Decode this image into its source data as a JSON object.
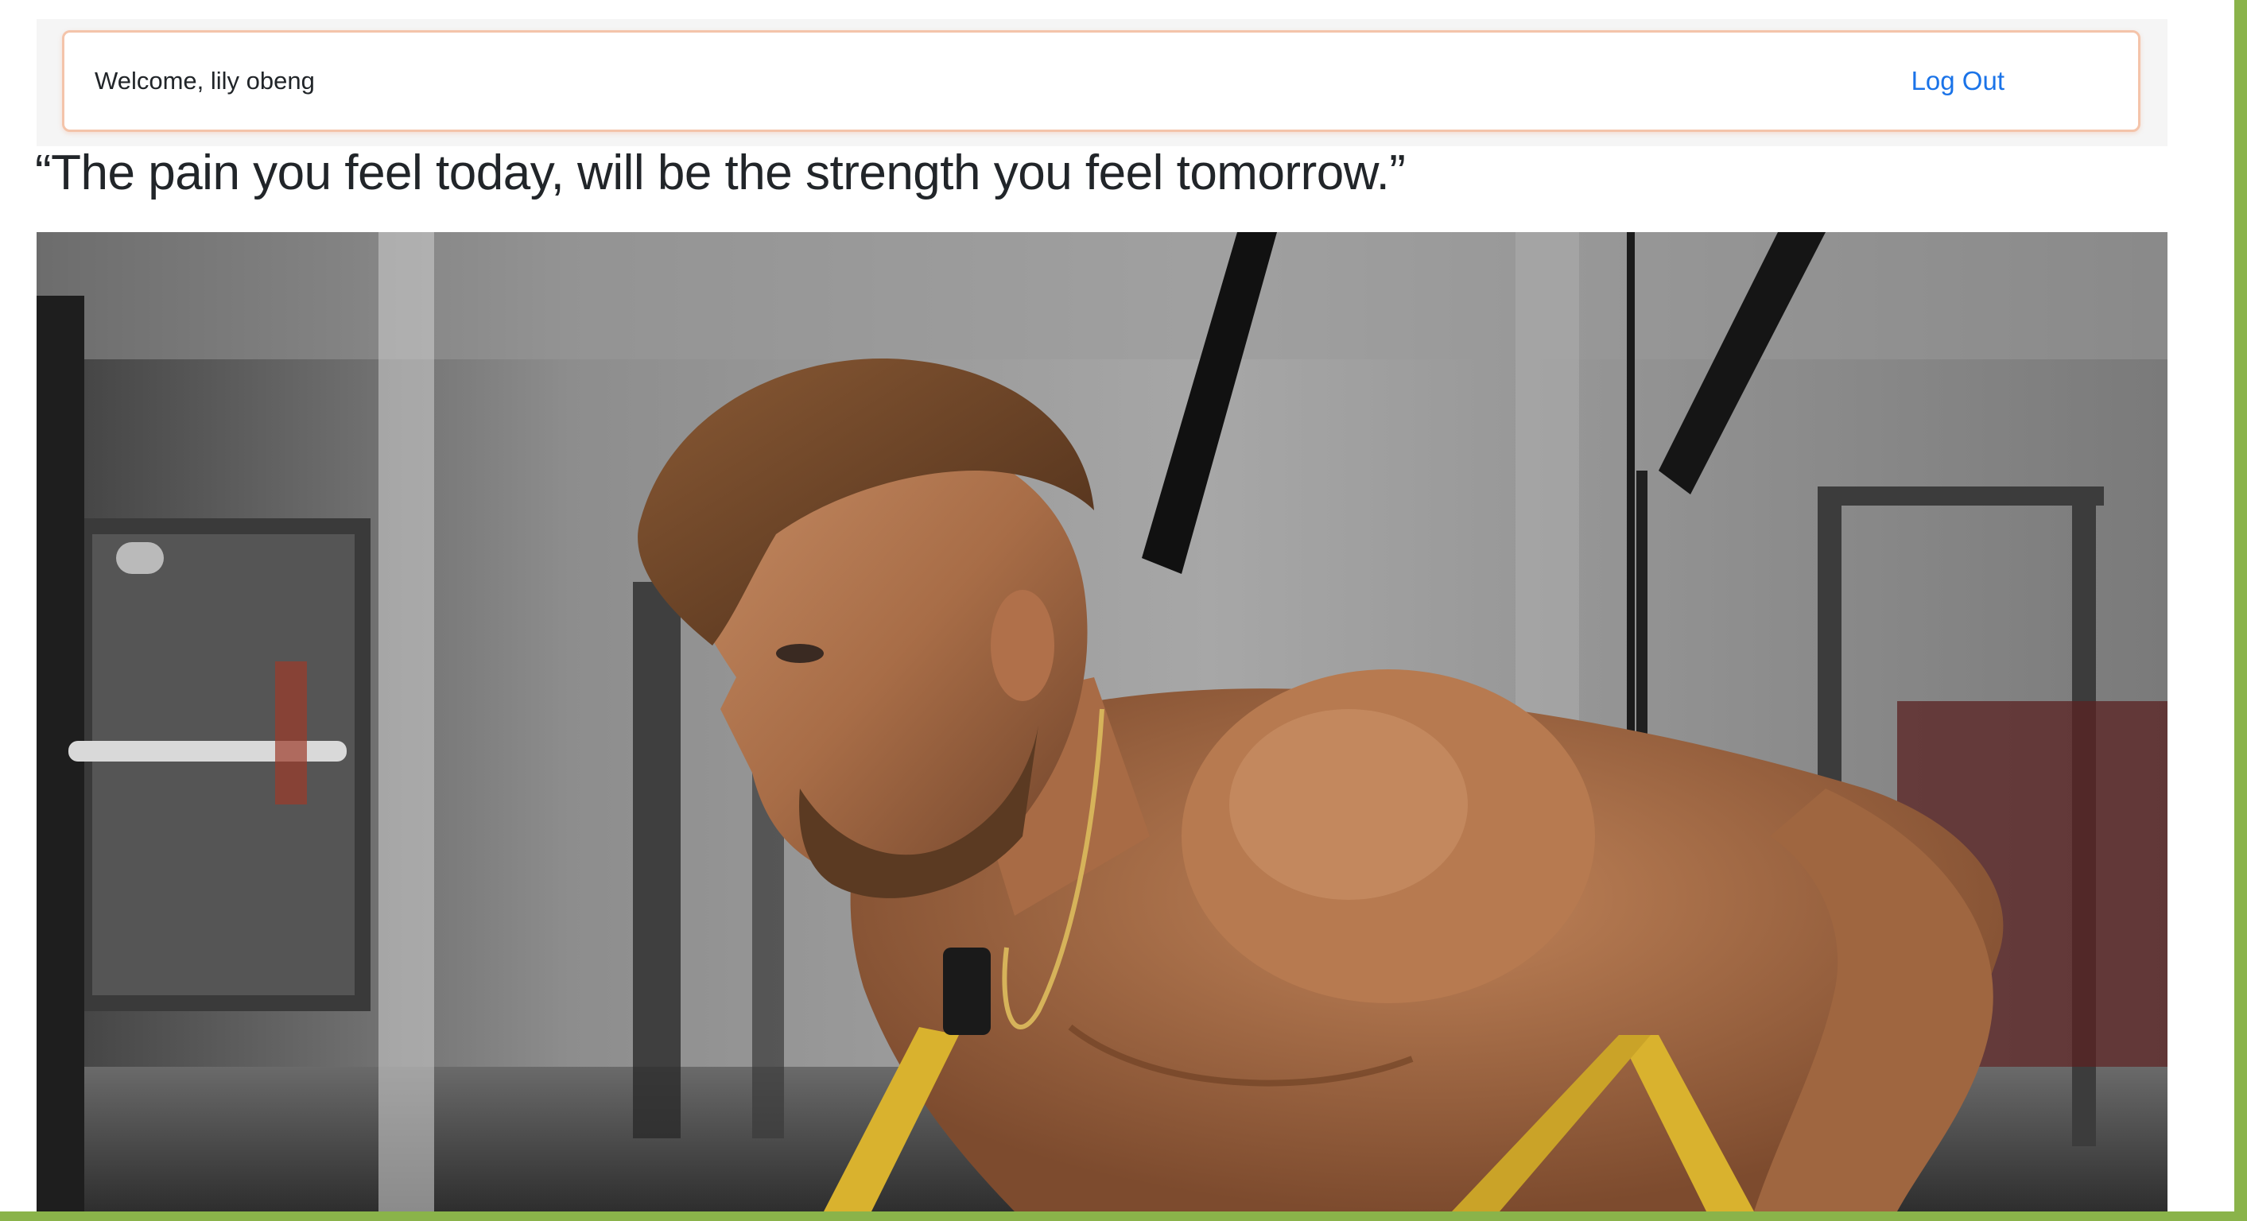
{
  "header": {
    "welcome_text": "Welcome, lily obeng",
    "logout_label": "Log Out"
  },
  "main": {
    "quote": "“The pain you feel today, will be the strength you feel tomorrow.”",
    "hero_image": {
      "subject": "man exercising with suspension trainer straps in a gym",
      "icon": "photo"
    }
  },
  "colors": {
    "accent_border": "#8ab34a",
    "card_border": "#f4c4aa",
    "link": "#1a73e8",
    "text": "#212529"
  }
}
